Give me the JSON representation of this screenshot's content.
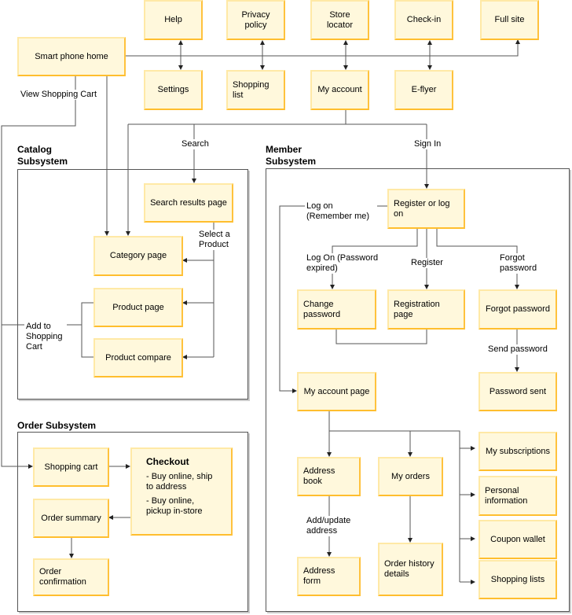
{
  "titles": {
    "catalog": "Catalog Subsystem",
    "order": "Order Subsystem",
    "member": "Member Subsystem"
  },
  "boxes": {
    "help": "Help",
    "privacy": "Privacy policy",
    "store": "Store locator",
    "checkin": "Check-in",
    "fullsite": "Full site",
    "home": "Smart phone home",
    "settings": "Settings",
    "shoplist": "Shopping list",
    "myaccount": "My account",
    "eflyer": "E-flyer",
    "search": "Search results page",
    "category": "Category page",
    "product": "Product page",
    "compare": "Product compare",
    "cart": "Shopping cart",
    "summary": "Order summary",
    "confirm": "Order confirmation",
    "register": "Register or log on",
    "changepw": "Change password",
    "regpage": "Registration page",
    "forgotpw": "Forgot password",
    "acctpage": "My account page",
    "pwsent": "Password sent",
    "addrbook": "Address book",
    "myorders": "My orders",
    "addrform": "Address form",
    "history": "Order history details",
    "subs": "My subscriptions",
    "personal": "Personal information",
    "coupon": "Coupon wallet",
    "lists": "Shopping lists"
  },
  "checkout": {
    "title": "Checkout",
    "option1": "- Buy online, ship to address",
    "option2": "- Buy online, pickup in-store"
  },
  "labels": {
    "view_cart": "View Shopping Cart",
    "search": "Search",
    "sign_in": "Sign In",
    "select_product": "Select a Product",
    "add_to_cart": "Add to Shopping Cart",
    "log_on_remember": "Log on (Remember me)",
    "log_on_expired": "Log On (Password expired)",
    "register": "Register",
    "forgot": "Forgot password",
    "send_password": "Send password",
    "add_update": "Add/update address"
  },
  "colors": {
    "box_fill": "#fff8dc",
    "box_border": "#ffc23d",
    "line": "#555555"
  }
}
